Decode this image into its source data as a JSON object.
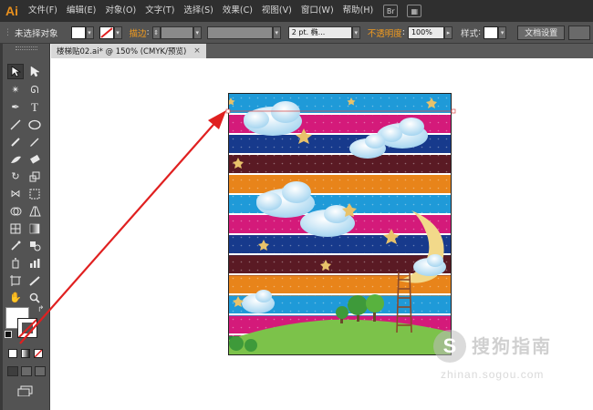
{
  "app": {
    "logo": "Ai"
  },
  "menu": [
    "文件(F)",
    "编辑(E)",
    "对象(O)",
    "文字(T)",
    "选择(S)",
    "效果(C)",
    "视图(V)",
    "窗口(W)",
    "帮助(H)"
  ],
  "menubar_icons": [
    "bridge-icon",
    "arrange-documents-icon"
  ],
  "control_bar": {
    "selection_label": "未选择对象",
    "stroke_label": "描边",
    "brush_value": "2 pt. 椭...",
    "opacity_label": "不透明度",
    "opacity_value": "100%",
    "style_label": "样式",
    "doc_setup_button": "文档设置",
    "colors": {
      "fill": "#ffffff",
      "stroke_none_slash": "#e02020",
      "accent_orange": "#f39c1f"
    }
  },
  "document_tab": {
    "title": "楼梯贴02.ai* @ 150% (CMYK/预览)",
    "close": "×"
  },
  "tools": [
    "selection-tool-icon",
    "direct-selection-tool-icon",
    "magic-wand-tool-icon",
    "lasso-tool-icon",
    "pen-tool-icon",
    "type-tool-icon",
    "line-tool-icon",
    "ellipse-tool-icon",
    "paintbrush-tool-icon",
    "pencil-tool-icon",
    "blob-brush-tool-icon",
    "eraser-tool-icon",
    "rotate-tool-icon",
    "scale-tool-icon",
    "width-tool-icon",
    "free-transform-tool-icon",
    "shape-builder-tool-icon",
    "perspective-grid-tool-icon",
    "mesh-tool-icon",
    "gradient-tool-icon",
    "eyedropper-tool-icon",
    "blend-tool-icon",
    "symbol-sprayer-tool-icon",
    "column-graph-tool-icon",
    "artboard-tool-icon",
    "slice-tool-icon",
    "hand-tool-icon",
    "zoom-tool-icon"
  ],
  "artwork": {
    "stripe_colors": [
      "#1f9ad8",
      "#d41a7a",
      "#173a8c",
      "#5a1a24",
      "#e8841a",
      "#1f9ad8",
      "#d41a7a",
      "#173a8c",
      "#5a1a24",
      "#e8841a",
      "#1f9ad8",
      "#d41a7a",
      "#2a8a3a"
    ],
    "colors": {
      "cloud": "#eaf6fd",
      "star": "#e8c26a",
      "moon": "#f2d98a",
      "hill": "#7cc24a",
      "ladder": "#8a4a2a",
      "arrow": "#e02020"
    }
  },
  "watermark": {
    "text": "搜狗指南",
    "url": "zhinan.sogou.com"
  }
}
